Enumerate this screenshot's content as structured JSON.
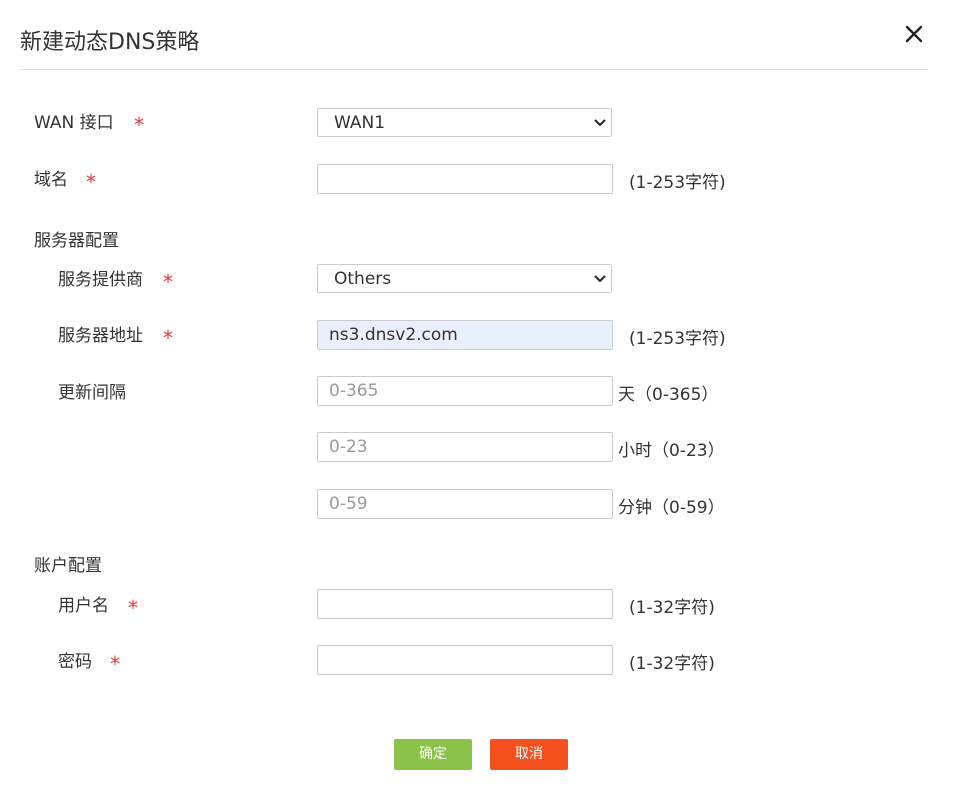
{
  "dialog": {
    "title": "新建动态DNS策略",
    "required_mark": "*"
  },
  "fields": {
    "wan_interface": {
      "label": "WAN 接口",
      "value": "WAN1"
    },
    "domain": {
      "label": "域名",
      "value": "",
      "hint": "(1-253字符)"
    },
    "server_section": {
      "title": "服务器配置"
    },
    "provider": {
      "label": "服务提供商",
      "value": "Others"
    },
    "server_address": {
      "label": "服务器地址",
      "value": "ns3.dnsv2.com",
      "hint": "(1-253字符)"
    },
    "update_interval": {
      "label": "更新间隔",
      "days": {
        "placeholder": "0-365",
        "unit": "天（0-365）"
      },
      "hours": {
        "placeholder": "0-23",
        "unit": "小时（0-23）"
      },
      "minutes": {
        "placeholder": "0-59",
        "unit": "分钟（0-59）"
      }
    },
    "account_section": {
      "title": "账户配置"
    },
    "username": {
      "label": "用户名",
      "value": "",
      "hint": "(1-32字符)"
    },
    "password": {
      "label": "密码",
      "value": "",
      "hint": "(1-32字符)"
    }
  },
  "buttons": {
    "confirm": "确定",
    "cancel": "取消"
  },
  "colors": {
    "required": "#e4393c",
    "confirm_button": "#8bc34a",
    "cancel_button": "#f4511e",
    "autofill_background": "#e8f0fe"
  },
  "icons": {
    "close": "close-icon",
    "dropdown": "chevron-down-icon"
  }
}
